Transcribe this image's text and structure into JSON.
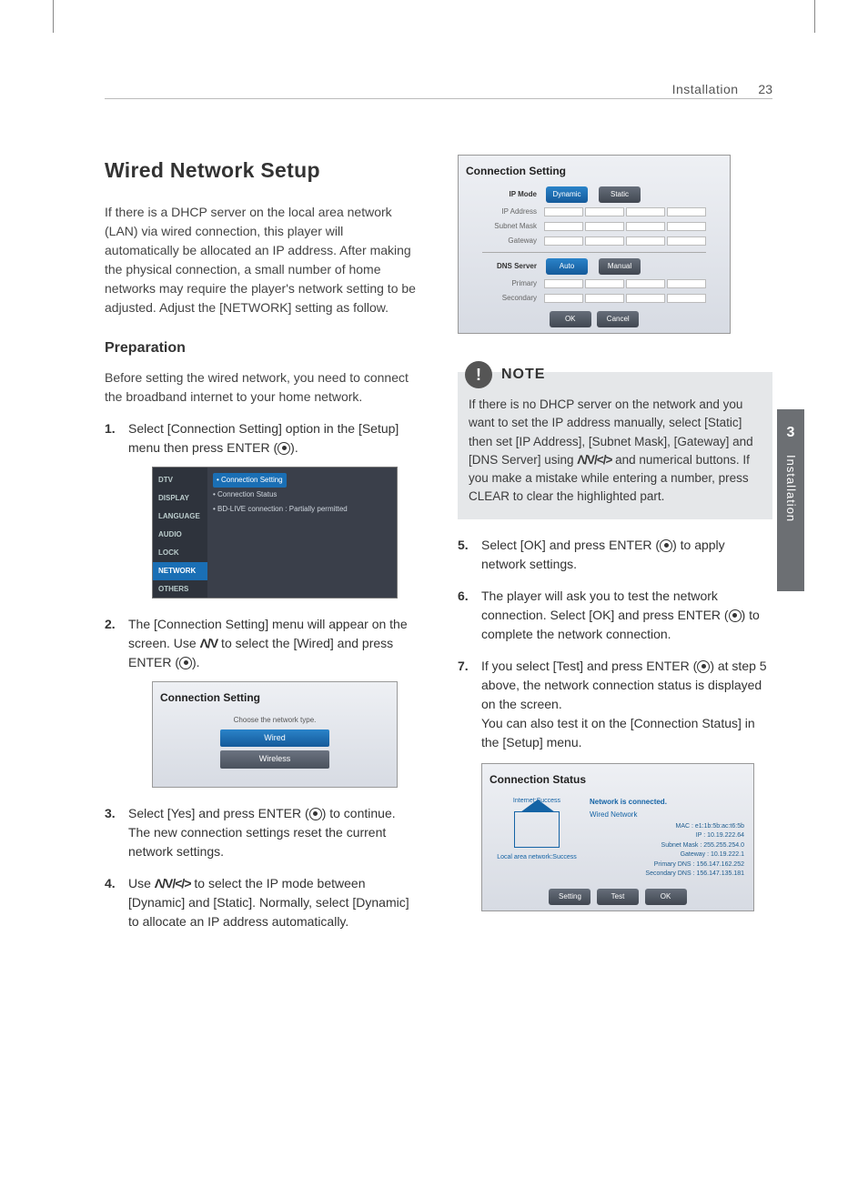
{
  "header": {
    "section": "Installation",
    "page": "23"
  },
  "side_tab": {
    "num": "3",
    "label": "Installation"
  },
  "left": {
    "title": "Wired Network Setup",
    "intro": "If there is a DHCP server on the local area network (LAN) via wired connection, this player will automatically be allocated an IP address. After making the physical connection, a small number of home networks may require the player's network setting to be adjusted. Adjust the [NETWORK] setting as follow.",
    "prep_title": "Preparation",
    "prep_text": "Before setting the wired network, you need to connect the broadband internet to your home network.",
    "steps": {
      "s1_a": "Select  [Connection Setting] option in the [Setup] menu then press ENTER (",
      "s1_b": ").",
      "s2_a": "The [Connection Setting] menu will appear on the screen. Use ",
      "s2_b": " to select the [Wired] and press ENTER (",
      "s2_c": ").",
      "s3_a": "Select [Yes] and press ENTER (",
      "s3_b": ") to continue. The new connection settings reset the current network settings.",
      "s4_a": "Use ",
      "s4_b": " to select the IP mode between [Dynamic] and [Static]. Normally, select [Dynamic] to allocate an IP address automatically."
    },
    "arrows_ud": "Λ/V",
    "arrows_all": "Λ/V/</>",
    "shot_setup": {
      "sidebar": [
        "DTV",
        "DISPLAY",
        "LANGUAGE",
        "AUDIO",
        "LOCK",
        "NETWORK",
        "OTHERS"
      ],
      "active_side": "NETWORK",
      "lines": [
        {
          "l": "• Connection Setting",
          "active": true
        },
        {
          "l": "• Connection Status",
          "active": false
        },
        {
          "l": "• BD-LIVE connection        : Partially permitted",
          "active": false
        }
      ]
    },
    "shot_pick": {
      "title": "Connection Setting",
      "hint": "Choose the network type.",
      "opts": [
        "Wired",
        "Wireless"
      ],
      "sel": "Wired"
    }
  },
  "right": {
    "shot_ip": {
      "title": "Connection Setting",
      "rows1_label": "IP Mode",
      "rows1_opts": [
        "Dynamic",
        "Static"
      ],
      "rows1_sel": "Dynamic",
      "addr_labels": [
        "IP Address",
        "Subnet Mask",
        "Gateway"
      ],
      "rows2_label": "DNS Server",
      "rows2_opts": [
        "Auto",
        "Manual"
      ],
      "rows2_sel": "Auto",
      "dns_labels": [
        "Primary",
        "Secondary"
      ],
      "btn_ok": "OK",
      "btn_cancel": "Cancel"
    },
    "note": {
      "title": "NOTE",
      "a": "If there is no DHCP server on the network and you want to set the IP address manually, select [Static] then set  [IP Address], [Subnet Mask], [Gateway] and [DNS Server] using ",
      "b": " and numerical buttons. If you make a mistake while entering a number, press CLEAR to clear the highlighted part."
    },
    "s5_a": "Select [OK] and press ENTER (",
    "s5_b": ") to apply network settings.",
    "s6_a": "The player will ask you to test the network connection. Select [OK] and press ENTER (",
    "s6_b": ") to complete the network connection.",
    "s7_a": "If you select [Test] and press ENTER (",
    "s7_b": ") at step 5 above, the network connection status is displayed on the screen.",
    "s7_c": "You can also test it on the [Connection Status] in the [Setup] menu.",
    "shot_status": {
      "title": "Connection Status",
      "internet_l": "Internet:Success",
      "lan_l": "Local area network:Success",
      "hdr": "Network is connected.",
      "sub": "Wired Network",
      "kv": [
        "MAC : e1:1b:5b:ac:t6:5b",
        "IP : 10.19.222.64",
        "Subnet Mask : 255.255.254.0",
        "Gateway : 10.19.222.1",
        "Primary DNS : 156.147.162.252",
        "Secondary DNS : 156.147.135.181"
      ],
      "btns": [
        "Setting",
        "Test",
        "OK"
      ]
    }
  }
}
